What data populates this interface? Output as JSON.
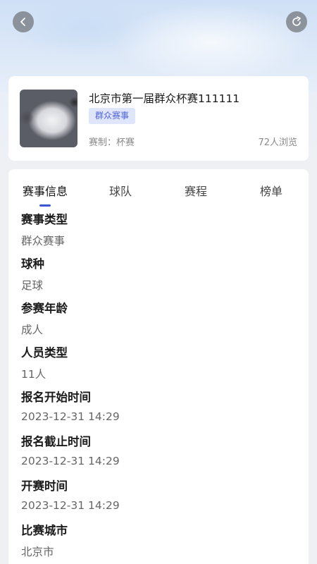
{
  "nav": {
    "back_icon": "chevron-left-icon",
    "share_icon": "share-icon"
  },
  "event": {
    "title": "北京市第一届群众杯赛111111",
    "tag": "群众赛事",
    "format": "赛制：杯赛",
    "views": "72人浏览"
  },
  "tabs": [
    {
      "label": "赛事信息",
      "active": true
    },
    {
      "label": "球队",
      "active": false
    },
    {
      "label": "赛程",
      "active": false
    },
    {
      "label": "榜单",
      "active": false
    }
  ],
  "fields": [
    {
      "label": "赛事类型",
      "value": "群众赛事"
    },
    {
      "label": "球种",
      "value": "足球"
    },
    {
      "label": "参赛年龄",
      "value": "成人"
    },
    {
      "label": "人员类型",
      "value": "11人"
    },
    {
      "label": "报名开始时间",
      "value": "2023-12-31 14:29"
    },
    {
      "label": "报名截止时间",
      "value": "2023-12-31 14:29"
    },
    {
      "label": "开赛时间",
      "value": "2023-12-31 14:29"
    },
    {
      "label": "比赛城市",
      "value": "北京市"
    }
  ],
  "colors": {
    "accent": "#3b55d9",
    "tag_bg": "#dfe5fb",
    "tag_text": "#4f63d6"
  }
}
